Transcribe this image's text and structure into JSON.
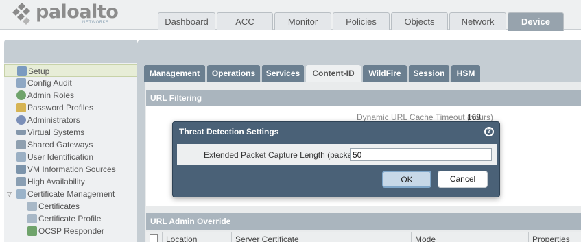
{
  "brand": {
    "name": "paloalto",
    "tagline": "NETWORKS"
  },
  "main_tabs": [
    {
      "label": "Dashboard"
    },
    {
      "label": "ACC"
    },
    {
      "label": "Monitor"
    },
    {
      "label": "Policies"
    },
    {
      "label": "Objects"
    },
    {
      "label": "Network"
    },
    {
      "label": "Device"
    }
  ],
  "sidebar": {
    "items": [
      {
        "label": "Setup"
      },
      {
        "label": "Config Audit"
      },
      {
        "label": "Admin Roles"
      },
      {
        "label": "Password Profiles"
      },
      {
        "label": "Administrators"
      },
      {
        "label": "Virtual Systems"
      },
      {
        "label": "Shared Gateways"
      },
      {
        "label": "User Identification"
      },
      {
        "label": "VM Information Sources"
      },
      {
        "label": "High Availability"
      },
      {
        "label": "Certificate Management"
      },
      {
        "label": "Certificates"
      },
      {
        "label": "Certificate Profile"
      },
      {
        "label": "OCSP Responder"
      }
    ]
  },
  "sub_tabs": [
    {
      "label": "Management"
    },
    {
      "label": "Operations"
    },
    {
      "label": "Services"
    },
    {
      "label": "Content-ID"
    },
    {
      "label": "WildFire"
    },
    {
      "label": "Session"
    },
    {
      "label": "HSM"
    }
  ],
  "url_filtering": {
    "title": "URL Filtering",
    "cache_label": "Dynamic URL Cache Timeout (hours)",
    "cache_value": "168"
  },
  "url_admin_override": {
    "title": "URL Admin Override",
    "columns": [
      "Location",
      "Server Certificate",
      "Mode",
      "Properties"
    ]
  },
  "modal": {
    "title": "Threat Detection Settings",
    "help_glyph": "?",
    "field_label": "Extended Packet Capture Length (packets)",
    "field_value": "50",
    "ok_label": "OK",
    "cancel_label": "Cancel"
  },
  "colors": {
    "accent_blue": "#4a6177",
    "active_tab": "#97a3ad",
    "subtab": "#6b7f90",
    "selection": "#e7edd7"
  }
}
